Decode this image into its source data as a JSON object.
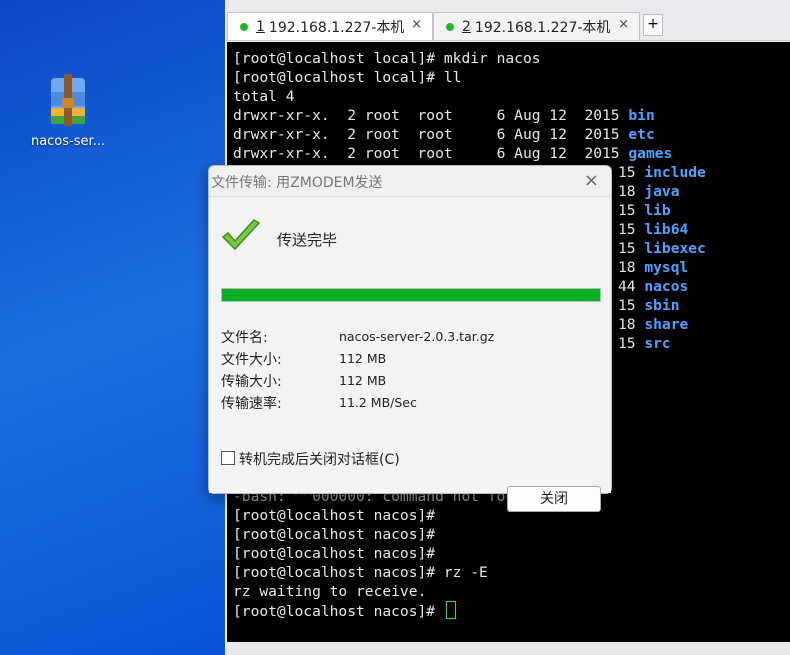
{
  "desktop": {
    "icon_label": "nacos-ser..."
  },
  "tabs": [
    {
      "num": "1",
      "label": " 192.168.1.227-本机",
      "close": "×"
    },
    {
      "num": "2",
      "label": " 192.168.1.227-本机",
      "close": "×"
    }
  ],
  "tab_add": "+",
  "terminal": {
    "lines": [
      "[root@localhost local]# mkdir nacos",
      "[root@localhost local]# ll",
      "total 4"
    ],
    "ls_rows": [
      {
        "prefix": "drwxr-xr-x.  2 root  root     6 Aug 12  2015 ",
        "name": "bin"
      },
      {
        "prefix": "drwxr-xr-x.  2 root  root     6 Aug 12  2015 ",
        "name": "etc"
      },
      {
        "prefix": "drwxr-xr-x.  2 root  root     6 Aug 12  2015 ",
        "name": "games"
      },
      {
        "prefix": "15 ",
        "name": "include"
      },
      {
        "prefix": "18 ",
        "name": "java"
      },
      {
        "prefix": "15 ",
        "name": "lib"
      },
      {
        "prefix": "15 ",
        "name": "lib64"
      },
      {
        "prefix": "15 ",
        "name": "libexec"
      },
      {
        "prefix": "18 ",
        "name": "mysql"
      },
      {
        "prefix": "44 ",
        "name": "nacos"
      },
      {
        "prefix": "15 ",
        "name": "sbin"
      },
      {
        "prefix": "18 ",
        "name": "share"
      },
      {
        "prefix": "15 ",
        "name": "src"
      }
    ],
    "bottom_lines": [
      "-bash: ^^000000: command not found",
      "[root@localhost nacos]#",
      "[root@localhost nacos]#",
      "[root@localhost nacos]#",
      "[root@localhost nacos]# rz -E",
      "rz waiting to receive.",
      "[root@localhost nacos]# "
    ]
  },
  "dialog": {
    "title": "文件传输: 用ZMODEM发送",
    "close": "×",
    "status": "传送完毕",
    "progress": 1.0,
    "fields": [
      {
        "label": "文件名:",
        "value": "nacos-server-2.0.3.tar.gz"
      },
      {
        "label": "文件大小:",
        "value": "112 MB"
      },
      {
        "label": "传输大小:",
        "value": "112 MB"
      },
      {
        "label": "传输速率:",
        "value": "11.2 MB/Sec"
      }
    ],
    "checkbox_label": "转机完成后关闭对话框(C)",
    "close_button": "关闭"
  },
  "colors": {
    "dir": "#4da3ff",
    "progress_fill": "#06b025",
    "tab_dot": "#1cb829"
  }
}
